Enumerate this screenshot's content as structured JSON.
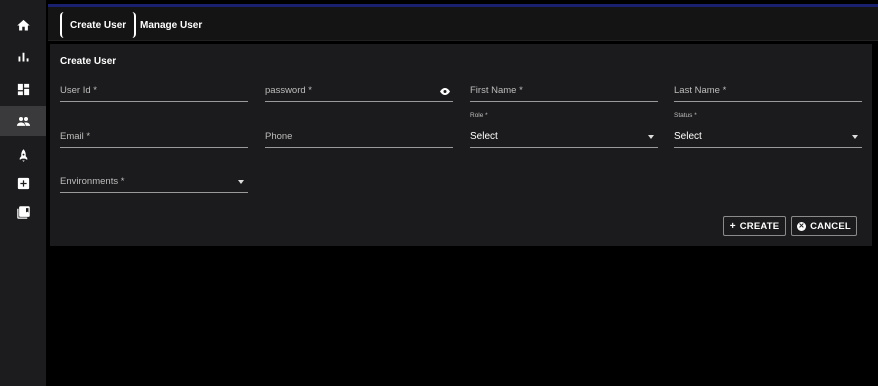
{
  "sidebar": {
    "items": [
      {
        "icon": "home-icon",
        "active": false
      },
      {
        "icon": "bar-chart-icon",
        "active": false
      },
      {
        "icon": "dashboard-icon",
        "active": false
      },
      {
        "icon": "users-icon",
        "active": true
      },
      {
        "icon": "rocket-icon",
        "active": false
      },
      {
        "icon": "add-box-icon",
        "active": false
      },
      {
        "icon": "library-icon",
        "active": false
      }
    ]
  },
  "tabs": [
    {
      "label": "Create User",
      "active": true
    },
    {
      "label": "Manage User",
      "active": false
    }
  ],
  "form": {
    "title": "Create User",
    "user_id_label": "User Id *",
    "password_label": "password *",
    "first_name_label": "First Name *",
    "last_name_label": "Last Name *",
    "email_label": "Email *",
    "phone_label": "Phone",
    "role_label": "Role *",
    "role_value": "Select",
    "status_label": "Status *",
    "status_value": "Select",
    "environments_label": "Environments *"
  },
  "actions": {
    "create_label": "CREATE",
    "create_prefix": "+",
    "cancel_label": "CANCEL"
  }
}
